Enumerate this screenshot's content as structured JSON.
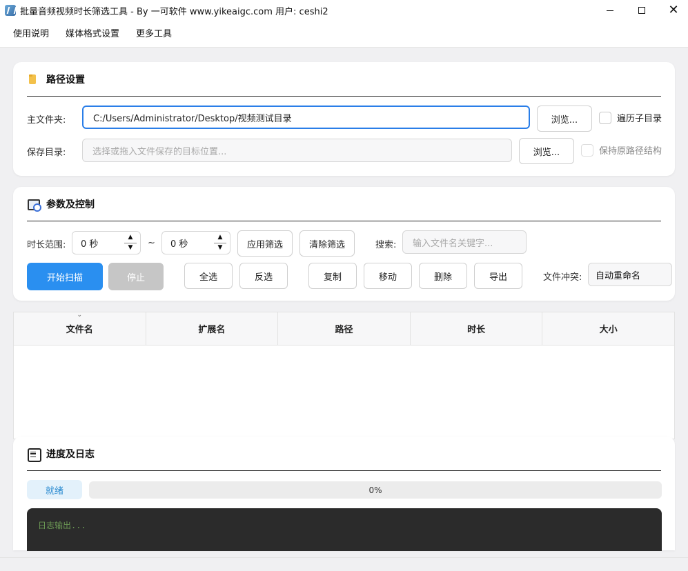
{
  "window": {
    "title": "批量音频视频时长筛选工具 - By 一可软件 www.yikeaigc.com 用户: ceshi2"
  },
  "menu": [
    "使用说明",
    "媒体格式设置",
    "更多工具"
  ],
  "path_section": {
    "title": "路径设置",
    "main_folder_label": "主文件夹:",
    "main_folder_value": "C:/Users/Administrator/Desktop/视频测试目录",
    "browse_label": "浏览...",
    "recursive_label": "遍历子目录",
    "save_dir_label": "保存目录:",
    "save_dir_placeholder": "选择或拖入文件保存的目标位置...",
    "browse2_label": "浏览...",
    "keep_structure_label": "保持原路径结构"
  },
  "params_section": {
    "title": "参数及控制",
    "duration_label": "时长范围:",
    "min_value": "0 秒",
    "range_sep": "~",
    "max_value": "0 秒",
    "apply_filter": "应用筛选",
    "clear_filter": "清除筛选",
    "search_label": "搜索:",
    "search_placeholder": "输入文件名关键字...",
    "start_scan": "开始扫描",
    "stop": "停止",
    "select_all": "全选",
    "invert": "反选",
    "copy": "复制",
    "move": "移动",
    "delete": "删除",
    "export": "导出",
    "conflict_label": "文件冲突:",
    "conflict_value": "自动重命名"
  },
  "table": {
    "columns": [
      "文件名",
      "扩展名",
      "路径",
      "时长",
      "大小"
    ]
  },
  "log_section": {
    "title": "进度及日志",
    "status": "就绪",
    "progress": 0,
    "progress_text": "0%",
    "log_placeholder": "日志输出..."
  }
}
